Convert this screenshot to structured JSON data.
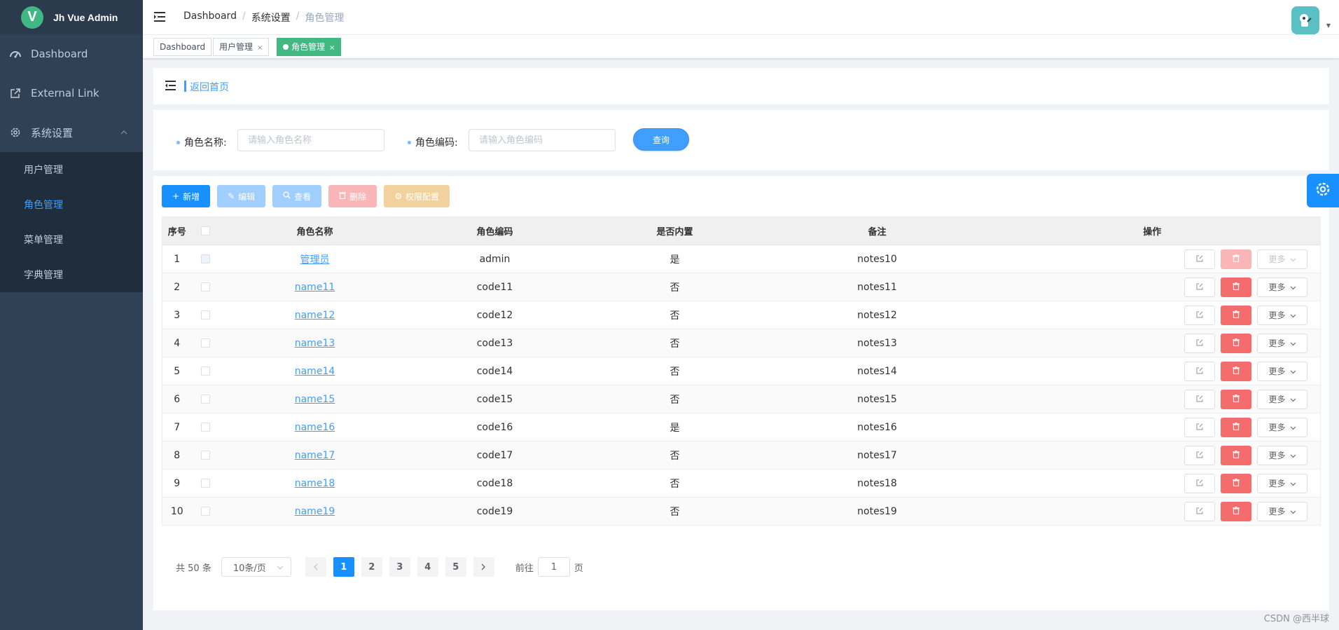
{
  "app": {
    "logo_letter": "V",
    "title": "Jh Vue Admin"
  },
  "sidebar": {
    "items": [
      {
        "label": "Dashboard",
        "icon": "dashboard-icon"
      },
      {
        "label": "External Link",
        "icon": "external-link-icon"
      },
      {
        "label": "系统设置",
        "icon": "gear-icon"
      }
    ],
    "subitems": [
      "用户管理",
      "角色管理",
      "菜单管理",
      "字典管理"
    ],
    "active_subitem": "角色管理"
  },
  "breadcrumb": {
    "items": [
      "Dashboard",
      "系统设置",
      "角色管理"
    ],
    "separator": "/"
  },
  "tags": [
    {
      "label": "Dashboard",
      "closable": false
    },
    {
      "label": "用户管理",
      "closable": true,
      "close": "×"
    },
    {
      "label": "角色管理",
      "closable": true,
      "active": true,
      "close": "×"
    }
  ],
  "back": {
    "label": "返回首页"
  },
  "search": {
    "name_label": "角色名称:",
    "name_placeholder": "请输入角色名称",
    "code_label": "角色编码:",
    "code_placeholder": "请输入角色编码",
    "query_label": "查询"
  },
  "toolbar": {
    "add": "新增",
    "edit": "编辑",
    "view": "查看",
    "delete": "删除",
    "perm": "权限配置"
  },
  "table": {
    "headers": [
      "序号",
      "角色名称",
      "角色编码",
      "是否内置",
      "备注",
      "操作"
    ],
    "rows": [
      {
        "index": "1",
        "name": "管理员",
        "code": "admin",
        "builtin": "是",
        "notes": "notes10",
        "disabled": true
      },
      {
        "index": "2",
        "name": "name11",
        "code": "code11",
        "builtin": "否",
        "notes": "notes11"
      },
      {
        "index": "3",
        "name": "name12",
        "code": "code12",
        "builtin": "否",
        "notes": "notes12"
      },
      {
        "index": "4",
        "name": "name13",
        "code": "code13",
        "builtin": "否",
        "notes": "notes13"
      },
      {
        "index": "5",
        "name": "name14",
        "code": "code14",
        "builtin": "否",
        "notes": "notes14"
      },
      {
        "index": "6",
        "name": "name15",
        "code": "code15",
        "builtin": "否",
        "notes": "notes15"
      },
      {
        "index": "7",
        "name": "name16",
        "code": "code16",
        "builtin": "是",
        "notes": "notes16"
      },
      {
        "index": "8",
        "name": "name17",
        "code": "code17",
        "builtin": "否",
        "notes": "notes17"
      },
      {
        "index": "9",
        "name": "name18",
        "code": "code18",
        "builtin": "否",
        "notes": "notes18"
      },
      {
        "index": "10",
        "name": "name19",
        "code": "code19",
        "builtin": "否",
        "notes": "notes19"
      }
    ],
    "more_label": "更多"
  },
  "pagination": {
    "total": "共 50 条",
    "page_size": "10条/页",
    "pages": [
      "1",
      "2",
      "3",
      "4",
      "5"
    ],
    "current": "1",
    "goto_prefix": "前往",
    "goto_value": "1",
    "goto_suffix": "页"
  },
  "watermark": "CSDN @西半球",
  "colors": {
    "primary": "#409eff",
    "sidebar": "#304156",
    "danger": "#f56c6c",
    "tag_active": "#42b983"
  }
}
